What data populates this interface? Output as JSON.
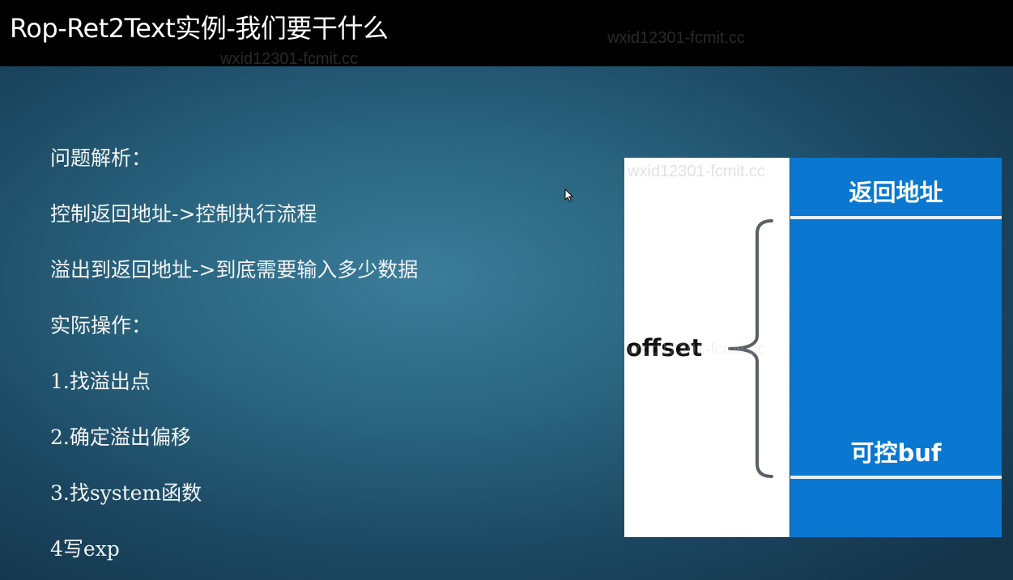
{
  "title": "Rop-Ret2Text实例-我们要干什么",
  "watermark": "wxid12301-fcmit.cc",
  "lines": [
    "问题解析：",
    "控制返回地址->控制执行流程",
    "溢出到返回地址->到底需要输入多少数据",
    "实际操作：",
    "1.找溢出点",
    "2.确定溢出偏移",
    "3.找system函数",
    "4写exp"
  ],
  "diagram": {
    "return_address_label": "返回地址",
    "buf_label": "可控buf",
    "offset_label": "offset",
    "colors": {
      "block": "#0a78d0",
      "separator": "#e3eef7",
      "brace": "#5a6068"
    }
  }
}
